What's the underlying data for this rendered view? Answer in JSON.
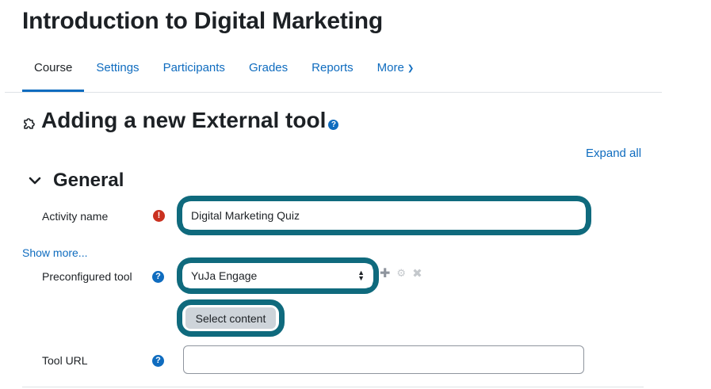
{
  "course": {
    "title": "Introduction to Digital Marketing"
  },
  "tabs": [
    {
      "label": "Course",
      "active": true
    },
    {
      "label": "Settings",
      "active": false
    },
    {
      "label": "Participants",
      "active": false
    },
    {
      "label": "Grades",
      "active": false
    },
    {
      "label": "Reports",
      "active": false
    },
    {
      "label": "More",
      "active": false
    }
  ],
  "page": {
    "heading": "Adding a new External tool",
    "help_icon": "question-icon",
    "module_icon": "puzzle-icon"
  },
  "expand_all": "Expand all",
  "section": {
    "title": "General",
    "icon": "chevron-down-icon"
  },
  "form": {
    "activity_name": {
      "label": "Activity name",
      "value": "Digital Marketing Quiz",
      "required_icon": "exclamation-icon"
    },
    "show_more": "Show more...",
    "preconfigured_tool": {
      "label": "Preconfigured tool",
      "value": "YuJa Engage",
      "actions": [
        "plus-icon",
        "gear-icon",
        "close-icon"
      ]
    },
    "select_content": "Select content",
    "tool_url": {
      "label": "Tool URL",
      "value": ""
    }
  },
  "colors": {
    "link": "#0f6cbf",
    "focus_ring": "#0f6a7d",
    "required": "#ca3120",
    "text": "#1d2125"
  }
}
